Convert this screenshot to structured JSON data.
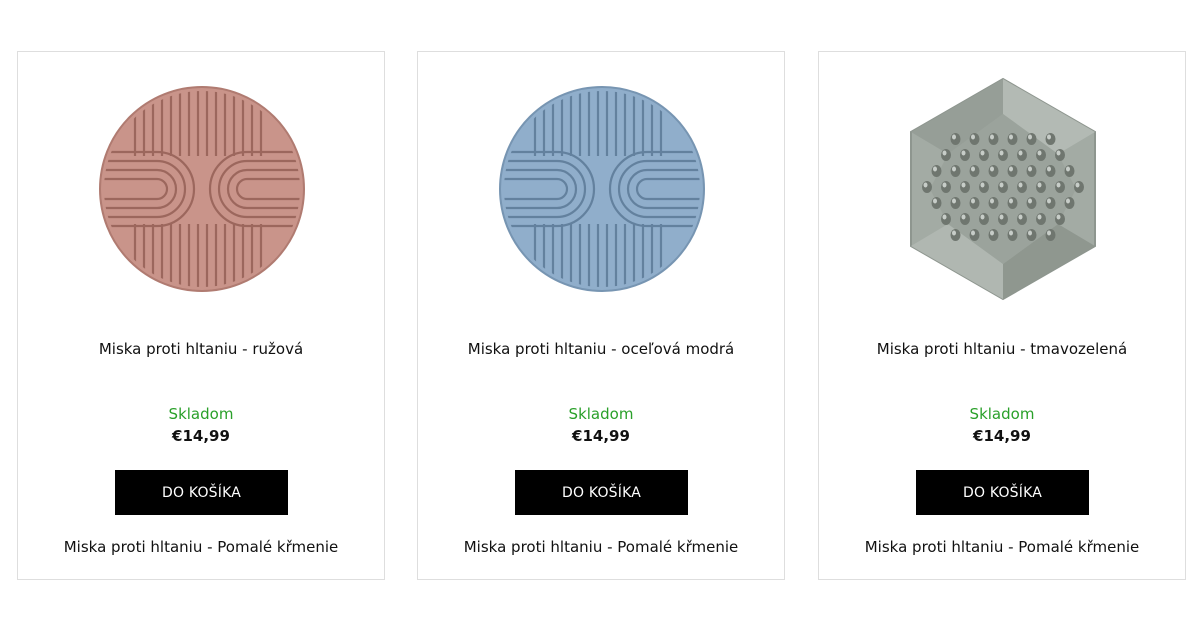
{
  "products": [
    {
      "title": "Miska proti hltaniu - ružová",
      "stock": "Skladom",
      "price": "€14,99",
      "button_label": "DO KOŠÍKA",
      "subtitle": "Miska proti hltaniu - Pomalé křmenie",
      "image_icon": "round-slow-feeder-bowl",
      "color": "#c9948a"
    },
    {
      "title": "Miska proti hltaniu - oceľová modrá",
      "stock": "Skladom",
      "price": "€14,99",
      "button_label": "DO KOŠÍKA",
      "subtitle": "Miska proti hltaniu - Pomalé křmenie",
      "image_icon": "round-slow-feeder-bowl",
      "color": "#90aecb"
    },
    {
      "title": "Miska proti hltaniu - tmavozelená",
      "stock": "Skladom",
      "price": "€14,99",
      "button_label": "DO KOŠÍKA",
      "subtitle": "Miska proti hltaniu - Pomalé křmenie",
      "image_icon": "hexagon-lick-mat",
      "color": "#98a099"
    }
  ],
  "colors": {
    "stock_green": "#2aa02a",
    "button_bg": "#000000",
    "card_border": "#dedede"
  }
}
